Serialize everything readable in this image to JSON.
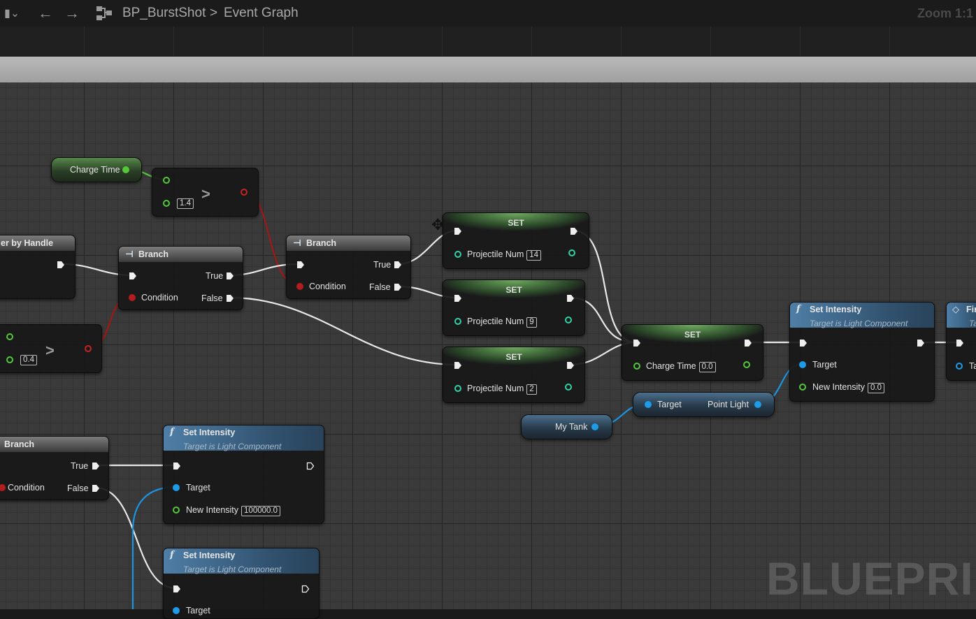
{
  "toolbar": {
    "asset_name": "BP_BurstShot",
    "breadcrumb_separator": ">",
    "graph_name": "Event Graph",
    "zoom": "Zoom 1:1"
  },
  "watermark": "BLUEPRINT",
  "nodes": {
    "charge_time_getter": {
      "label": "Charge Time"
    },
    "compare_top": {
      "op": ">",
      "value": "1.4"
    },
    "timer_by_handle": {
      "title": "er by Handle"
    },
    "compare_left": {
      "op": ">",
      "value": "0.4"
    },
    "branch_a": {
      "title": "Branch",
      "true": "True",
      "condition": "Condition",
      "false": "False"
    },
    "branch_b": {
      "title": "Branch",
      "true": "True",
      "condition": "Condition",
      "false": "False"
    },
    "set_a": {
      "title": "SET",
      "var": "Projectile Num",
      "value": "14"
    },
    "set_b": {
      "title": "SET",
      "var": "Projectile Num",
      "value": "9"
    },
    "set_c": {
      "title": "SET",
      "var": "Projectile Num",
      "value": "2"
    },
    "set_charge": {
      "title": "SET",
      "var": "Charge Time",
      "value": "0.0"
    },
    "set_intensity_right": {
      "title": "Set Intensity",
      "subtitle": "Target is Light Component",
      "target": "Target",
      "new_intensity": "New Intensity",
      "value": "0.0"
    },
    "fire_partial": {
      "title": "Fir",
      "subtitle": "Ta",
      "target": "Ta"
    },
    "point_light_getter": {
      "target": "Target",
      "output": "Point Light"
    },
    "my_tank_getter": {
      "label": "My Tank"
    },
    "branch_c": {
      "title": "Branch",
      "true": "True",
      "condition": "Condition",
      "false": "False"
    },
    "set_intensity_mid": {
      "title": "Set Intensity",
      "subtitle": "Target is Light Component",
      "target": "Target",
      "new_intensity": "New Intensity",
      "value": "100000.0"
    },
    "set_intensity_bottom": {
      "title": "Set Intensity",
      "subtitle": "Target is Light Component",
      "target": "Target"
    }
  }
}
